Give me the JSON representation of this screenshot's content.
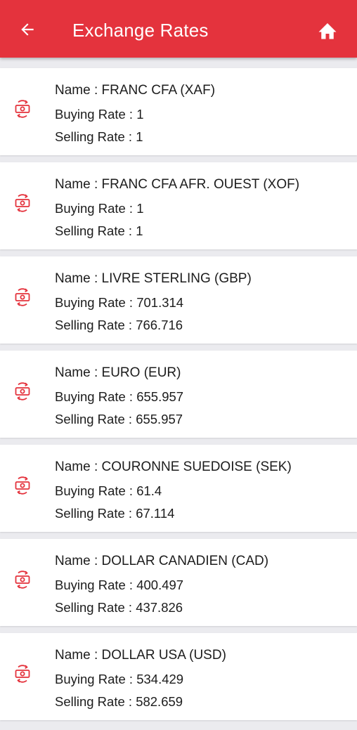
{
  "app_bar": {
    "title": "Exchange Rates",
    "back_icon": "arrow-left-icon",
    "home_icon": "home-icon",
    "background_color": "#e4333d",
    "text_color": "#ffffff"
  },
  "labels": {
    "name_prefix": "Name : ",
    "buying_prefix": "Buying Rate : ",
    "selling_prefix": "Selling Rate : "
  },
  "rates": [
    {
      "name": "FRANC CFA (XAF)",
      "buying": "1",
      "selling": "1"
    },
    {
      "name": "FRANC CFA AFR. OUEST (XOF)",
      "buying": "1",
      "selling": "1"
    },
    {
      "name": "LIVRE STERLING (GBP)",
      "buying": "701.314",
      "selling": "766.716"
    },
    {
      "name": "EURO (EUR)",
      "buying": "655.957",
      "selling": "655.957"
    },
    {
      "name": "COURONNE SUEDOISE (SEK)",
      "buying": "61.4",
      "selling": "67.114"
    },
    {
      "name": "DOLLAR CANADIEN (CAD)",
      "buying": "400.497",
      "selling": "437.826"
    },
    {
      "name": "DOLLAR USA (USD)",
      "buying": "534.429",
      "selling": "582.659"
    }
  ],
  "item_icon": "currency-exchange-icon",
  "accent_color": "#e4333d"
}
